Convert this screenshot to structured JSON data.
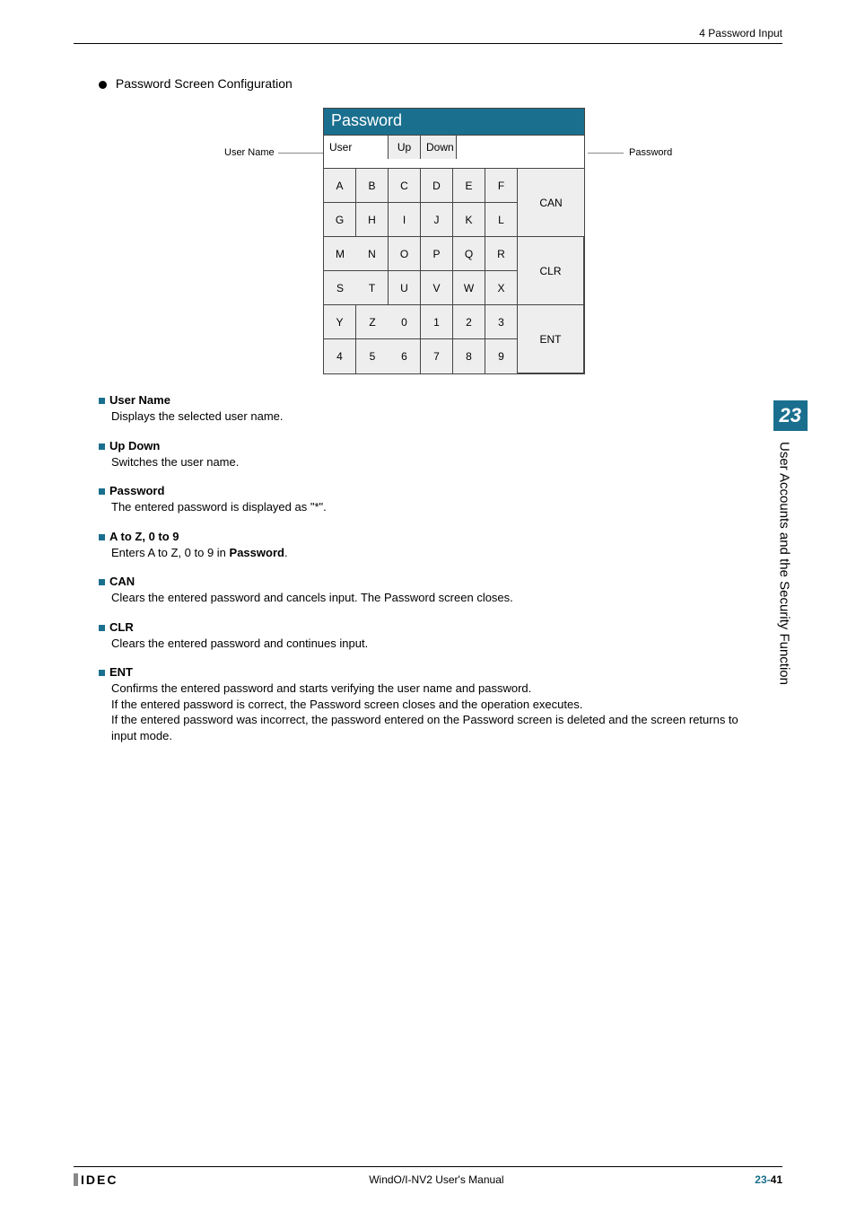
{
  "header": {
    "breadcrumb": "4 Password Input"
  },
  "section_title": "Password Screen Configuration",
  "leaders": {
    "username": "User Name",
    "password": "Password"
  },
  "panel": {
    "title": "Password",
    "user_label": "User",
    "up_label": "Up",
    "down_label": "Down",
    "password_value": "",
    "keys": {
      "r1": [
        "A",
        "B",
        "C",
        "D",
        "E",
        "F"
      ],
      "r2": [
        "G",
        "H",
        "I",
        "J",
        "K",
        "L"
      ],
      "r3": [
        "M",
        "N",
        "O",
        "P",
        "Q",
        "R"
      ],
      "r4": [
        "S",
        "T",
        "U",
        "V",
        "W",
        "X"
      ],
      "r5": [
        "Y",
        "Z",
        "0",
        "1",
        "2",
        "3"
      ],
      "r6": [
        "4",
        "5",
        "6",
        "7",
        "8",
        "9"
      ]
    },
    "side": {
      "can": "CAN",
      "clr": "CLR",
      "ent": "ENT"
    }
  },
  "descs": {
    "username": {
      "title": "User Name",
      "body": "Displays the selected user name."
    },
    "updown": {
      "title": "Up Down",
      "body": "Switches the user name."
    },
    "password": {
      "title": "Password",
      "body": "The entered password is displayed as \"*\"."
    },
    "az09": {
      "title": "A to Z, 0 to 9",
      "body_pre": "Enters A to Z, 0 to 9 in ",
      "body_bold": "Password",
      "body_post": "."
    },
    "can": {
      "title": "CAN",
      "body": "Clears the entered password and cancels input. The Password screen closes."
    },
    "clr": {
      "title": "CLR",
      "body": "Clears the entered password and continues input."
    },
    "ent": {
      "title": "ENT",
      "l1": "Confirms the entered password and starts verifying the user name and password.",
      "l2": "If the entered password is correct, the Password screen closes and the operation executes.",
      "l3": "If the entered password was incorrect, the password entered on the Password screen is deleted and the screen returns to input mode."
    }
  },
  "tab": {
    "number": "23",
    "text": "User Accounts and the Security Function"
  },
  "footer": {
    "brand": "IDEC",
    "manual": "WindO/I-NV2 User's Manual",
    "page_prefix": "23-",
    "page_num": "41"
  }
}
